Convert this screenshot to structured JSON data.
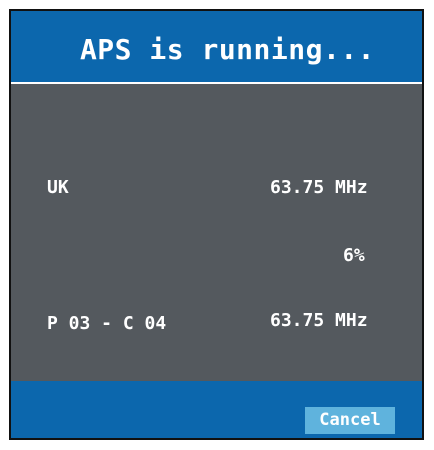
{
  "dialog": {
    "title": "APS is running...",
    "country": "UK",
    "frequency_top": "63.75 MHz",
    "progress_percent": "6%",
    "program_channel": "P 03 - C 04",
    "frequency_bottom": "63.75 MHz",
    "cancel_label": "Cancel"
  },
  "colors": {
    "accent_blue": "#0c67ad",
    "content_gray": "#54595e",
    "button_blue": "#5fb3dd",
    "text": "#ffffff"
  }
}
